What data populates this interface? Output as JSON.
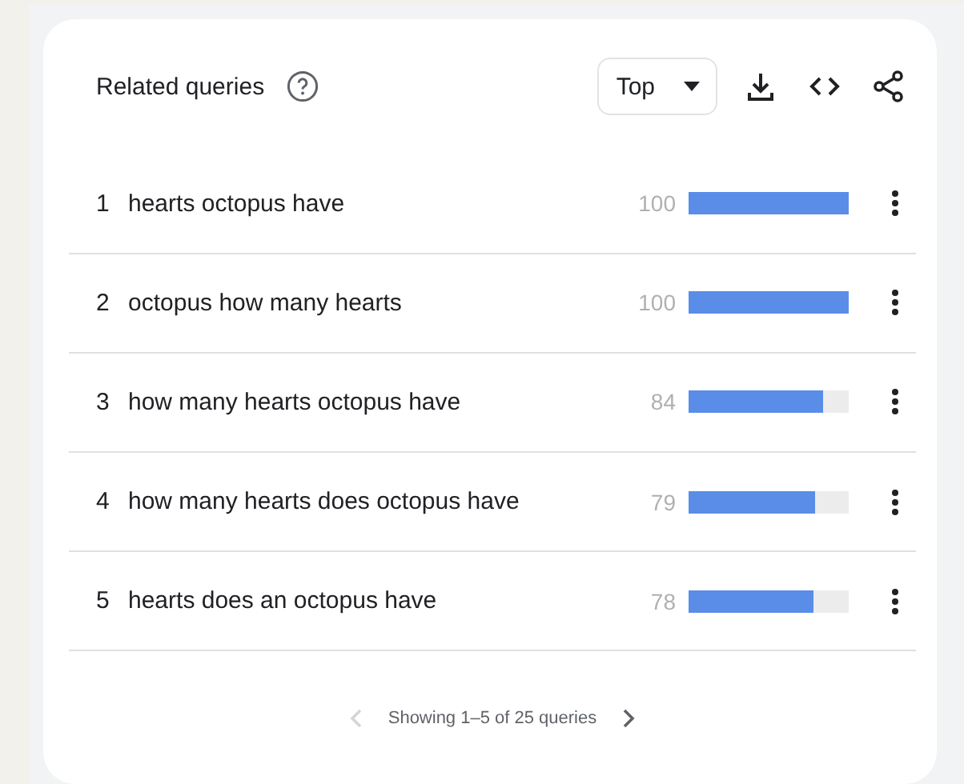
{
  "card": {
    "title": "Related queries",
    "filter": "Top",
    "rows": [
      {
        "rank": "1",
        "query": "hearts octopus have",
        "value": "100",
        "level": 1
      },
      {
        "rank": "2",
        "query": "octopus how many hearts",
        "value": "100",
        "level": 1
      },
      {
        "rank": "3",
        "query": "how many hearts octopus have",
        "value": "84",
        "level": 0.84
      },
      {
        "rank": "4",
        "query": "how many hearts does octopus have",
        "value": "79",
        "level": 0.79
      },
      {
        "rank": "5",
        "query": "hearts does an octopus have",
        "value": "78",
        "level": 0.78
      }
    ],
    "pagination": {
      "text": "Showing 1–5 of 25 queries",
      "previous_disabled": true,
      "next_disabled": false
    }
  }
}
